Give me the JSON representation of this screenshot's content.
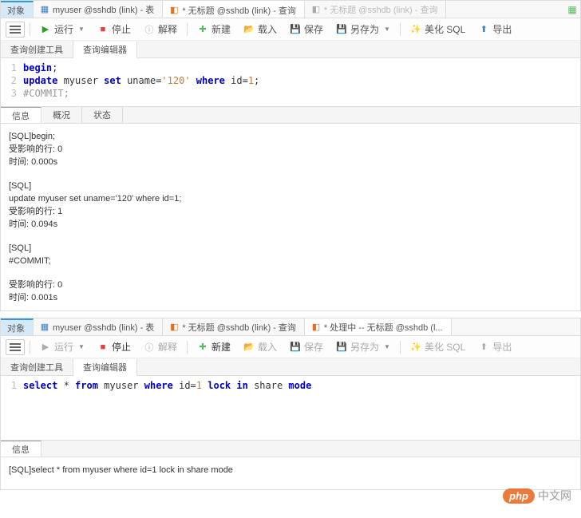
{
  "panel1": {
    "tabs": [
      {
        "label": "对象"
      },
      {
        "label": "myuser @sshdb (link) - 表"
      },
      {
        "label": "* 无标题 @sshdb (link) - 查询",
        "active": true
      },
      {
        "label": "* 无标题 @sshdb (link) - 查询"
      }
    ],
    "toolbar": {
      "run": "运行",
      "stop": "停止",
      "explain": "解释",
      "new": "新建",
      "load": "载入",
      "save": "保存",
      "saveas": "另存为",
      "beautify": "美化 SQL",
      "export": "导出"
    },
    "subtabs": [
      {
        "label": "查询创建工具"
      },
      {
        "label": "查询编辑器",
        "active": true
      }
    ],
    "code": [
      {
        "n": "1",
        "tokens": [
          {
            "t": "begin",
            "c": "kw"
          },
          {
            "t": ";",
            "c": ""
          }
        ]
      },
      {
        "n": "2",
        "tokens": [
          {
            "t": "update",
            "c": "kw"
          },
          {
            "t": " myuser ",
            "c": ""
          },
          {
            "t": "set",
            "c": "kw"
          },
          {
            "t": " uname=",
            "c": ""
          },
          {
            "t": "'120'",
            "c": "str"
          },
          {
            "t": " ",
            "c": ""
          },
          {
            "t": "where",
            "c": "kw"
          },
          {
            "t": " id=",
            "c": ""
          },
          {
            "t": "1",
            "c": "str"
          },
          {
            "t": ";",
            "c": ""
          }
        ]
      },
      {
        "n": "3",
        "tokens": [
          {
            "t": "#COMMIT;",
            "c": "comment"
          }
        ]
      }
    ],
    "resultTabs": [
      {
        "label": "信息",
        "active": true
      },
      {
        "label": "概况"
      },
      {
        "label": "状态"
      }
    ],
    "output": [
      [
        "[SQL]begin;",
        "受影响的行: 0",
        "时间: 0.000s"
      ],
      [
        "[SQL]",
        "update myuser set uname='120' where id=1;",
        "受影响的行: 1",
        "时间: 0.094s"
      ],
      [
        "[SQL]",
        "#COMMIT;"
      ],
      [
        "受影响的行: 0",
        "时间: 0.001s"
      ]
    ]
  },
  "panel2": {
    "tabs": [
      {
        "label": "对象"
      },
      {
        "label": "myuser @sshdb (link) - 表"
      },
      {
        "label": "* 无标题 @sshdb (link) - 查询"
      },
      {
        "label": "* 处理中 -- 无标题 @sshdb (l...",
        "active": true
      }
    ],
    "toolbar": {
      "run": "运行",
      "stop": "停止",
      "explain": "解释",
      "new": "新建",
      "load": "载入",
      "save": "保存",
      "saveas": "另存为",
      "beautify": "美化 SQL",
      "export": "导出"
    },
    "subtabs": [
      {
        "label": "查询创建工具"
      },
      {
        "label": "查询编辑器",
        "active": true
      }
    ],
    "code": [
      {
        "n": "1",
        "tokens": [
          {
            "t": "select",
            "c": "kw"
          },
          {
            "t": " * ",
            "c": ""
          },
          {
            "t": "from",
            "c": "kw"
          },
          {
            "t": " myuser ",
            "c": ""
          },
          {
            "t": "where",
            "c": "kw"
          },
          {
            "t": " id=",
            "c": ""
          },
          {
            "t": "1",
            "c": "str"
          },
          {
            "t": " ",
            "c": ""
          },
          {
            "t": "lock",
            "c": "kw"
          },
          {
            "t": " ",
            "c": ""
          },
          {
            "t": "in",
            "c": "kw"
          },
          {
            "t": " share ",
            "c": ""
          },
          {
            "t": "mode",
            "c": "kw"
          }
        ]
      }
    ],
    "resultTabs": [
      {
        "label": "信息",
        "active": true
      }
    ],
    "output": [
      [
        "[SQL]select * from myuser where id=1 lock in share mode"
      ]
    ]
  },
  "watermark": {
    "badge": "php",
    "text": "中文网"
  }
}
